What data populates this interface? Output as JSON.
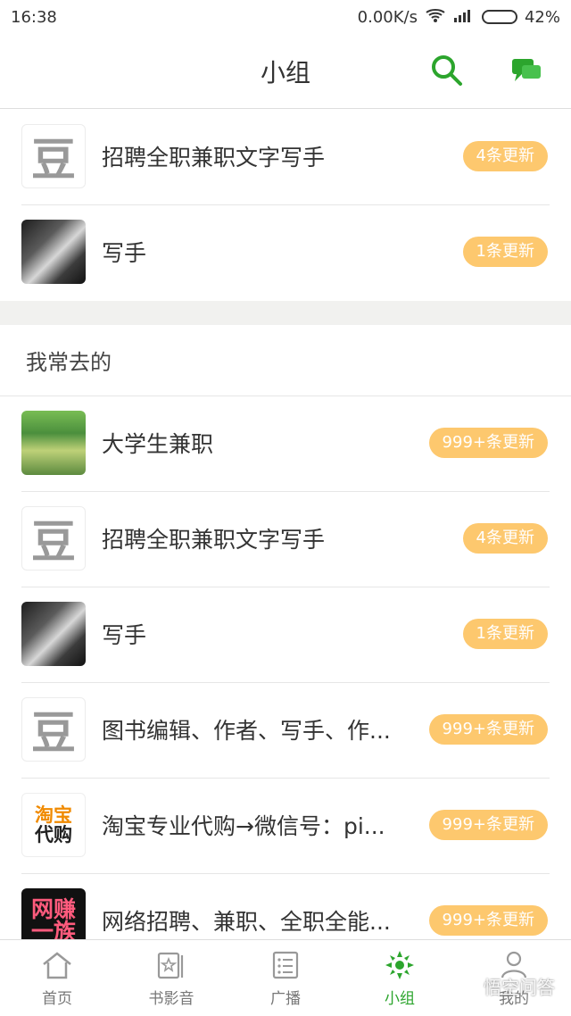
{
  "status": {
    "time": "16:38",
    "network": "0.00K/s",
    "battery": "42%",
    "battery_level": 0.42
  },
  "header": {
    "title": "小组",
    "search_icon": "search-icon",
    "message_icon": "message-icon"
  },
  "joined": [
    {
      "title": "招聘全职兼职文字写手",
      "badge": "4条更新",
      "avatar": "douban-logo"
    },
    {
      "title": "写手",
      "badge": "1条更新",
      "avatar": "dark-photo"
    }
  ],
  "frequent_section": {
    "title": "我常去的",
    "items": [
      {
        "title": "大学生兼职",
        "badge": "999+条更新",
        "avatar": "green-photo"
      },
      {
        "title": "招聘全职兼职文字写手",
        "badge": "4条更新",
        "avatar": "douban-logo"
      },
      {
        "title": "写手",
        "badge": "1条更新",
        "avatar": "dark-photo"
      },
      {
        "title": "图书编辑、作者、写手、作...",
        "badge": "999+条更新",
        "avatar": "douban-logo"
      },
      {
        "title": "淘宝专业代购→微信号：pi...",
        "badge": "999+条更新",
        "avatar": "taobao-logo",
        "avatar_text": [
          "淘宝",
          "代购"
        ]
      },
      {
        "title": "网络招聘、兼职、全职全能...",
        "badge": "999+条更新",
        "avatar": "wangzhuan-logo",
        "avatar_text": [
          "网赚",
          "一族"
        ]
      }
    ]
  },
  "bottom_nav": [
    {
      "label": "首页",
      "icon": "home-icon"
    },
    {
      "label": "书影音",
      "icon": "book-icon"
    },
    {
      "label": "广播",
      "icon": "broadcast-icon"
    },
    {
      "label": "小组",
      "icon": "group-icon",
      "active": true
    },
    {
      "label": "我的",
      "icon": "profile-icon"
    }
  ],
  "watermark": "悟空问答",
  "colors": {
    "accent": "#2ca52d",
    "badge": "#fdc86e",
    "divider": "#e6e6e6"
  }
}
